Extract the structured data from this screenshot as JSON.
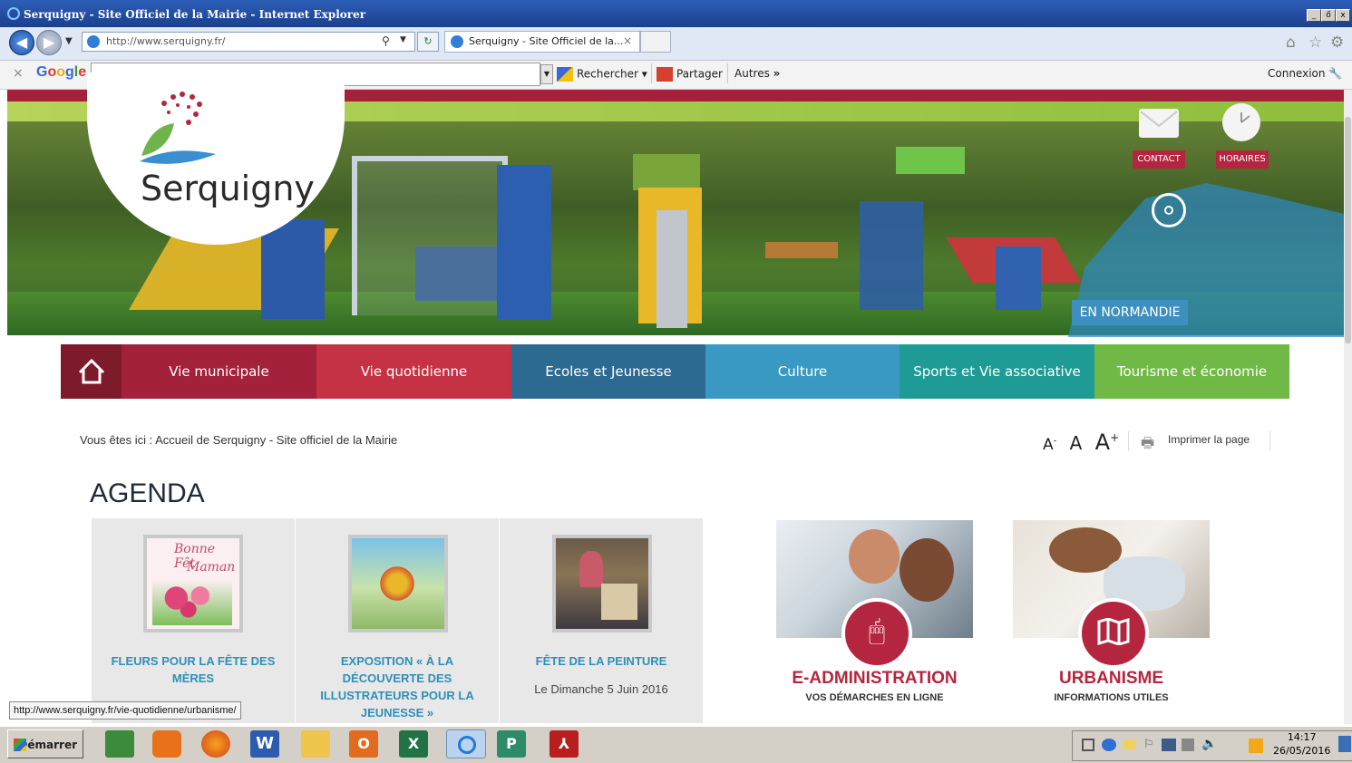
{
  "window": {
    "title": "Serquigny - Site Officiel de la Mairie - Internet Explorer",
    "controls": [
      "_",
      "ő",
      "x"
    ]
  },
  "browser": {
    "address": "http://www.serquigny.fr/",
    "tab_title": "Serquigny - Site Officiel de la...",
    "tab_close": "×",
    "right_icons": [
      "home-icon",
      "star-icon",
      "gear-icon"
    ]
  },
  "google_toolbar": {
    "close": "×",
    "logo": "Google",
    "search_value": "",
    "search_label": "Rechercher",
    "share_label": "Partager",
    "more_label": "Autres",
    "more_glyph": "»",
    "login_label": "Connexion"
  },
  "header": {
    "site_name": "Serquigny",
    "contact_label": "CONTACT",
    "horaires_label": "HORAIRES",
    "region_label": "EN NORMANDIE"
  },
  "nav": {
    "items": [
      {
        "label": "Vie municipale",
        "color": "#a4213c"
      },
      {
        "label": "Vie quotidienne",
        "color": "#c63245"
      },
      {
        "label": "Ecoles et Jeunesse",
        "color": "#2d6a91"
      },
      {
        "label": "Culture",
        "color": "#3a99c2"
      },
      {
        "label": "Sports et Vie associative",
        "color": "#1e9b94"
      },
      {
        "label": "Tourisme et économie",
        "color": "#71b946"
      }
    ],
    "home_color": "#7d1a2c"
  },
  "breadcrumb": "Vous êtes ici : Accueil de Serquigny - Site officiel de la Mairie",
  "text_tools": {
    "smaller": "A",
    "smaller_sup": "-",
    "normal": "A",
    "bigger": "A",
    "bigger_sup": "+",
    "print": "Imprimer la page"
  },
  "agenda": {
    "title": "AGENDA",
    "items": [
      {
        "title_l1": "FLEURS POUR LA FÊTE DES",
        "title_l2": "MÈRES",
        "title_l3": "",
        "title_l4": "",
        "date": "",
        "thumb_text_1": "Bonne Fêt",
        "thumb_text_2": "Maman"
      },
      {
        "title_l1": "EXPOSITION « À LA",
        "title_l2": "DÉCOUVERTE DES",
        "title_l3": "ILLUSTRATEURS POUR LA",
        "title_l4": "JEUNESSE »",
        "date": ""
      },
      {
        "title_l1": "FÊTE DE LA PEINTURE",
        "title_l2": "",
        "title_l3": "",
        "title_l4": "",
        "date": "Le Dimanche 5 Juin 2016"
      }
    ]
  },
  "promos": [
    {
      "title": "E-ADMINISTRATION",
      "subtitle": "VOS DÉMARCHES EN LIGNE",
      "icon": "mouse-icon"
    },
    {
      "title": "URBANISME",
      "subtitle": "INFORMATIONS UTILES",
      "icon": "map-icon"
    }
  ],
  "status_url": "http://www.serquigny.fr/vie-quotidienne/urbanisme/",
  "taskbar": {
    "start_label": "Démarrer",
    "time": "14:17",
    "date": "26/05/2016"
  }
}
